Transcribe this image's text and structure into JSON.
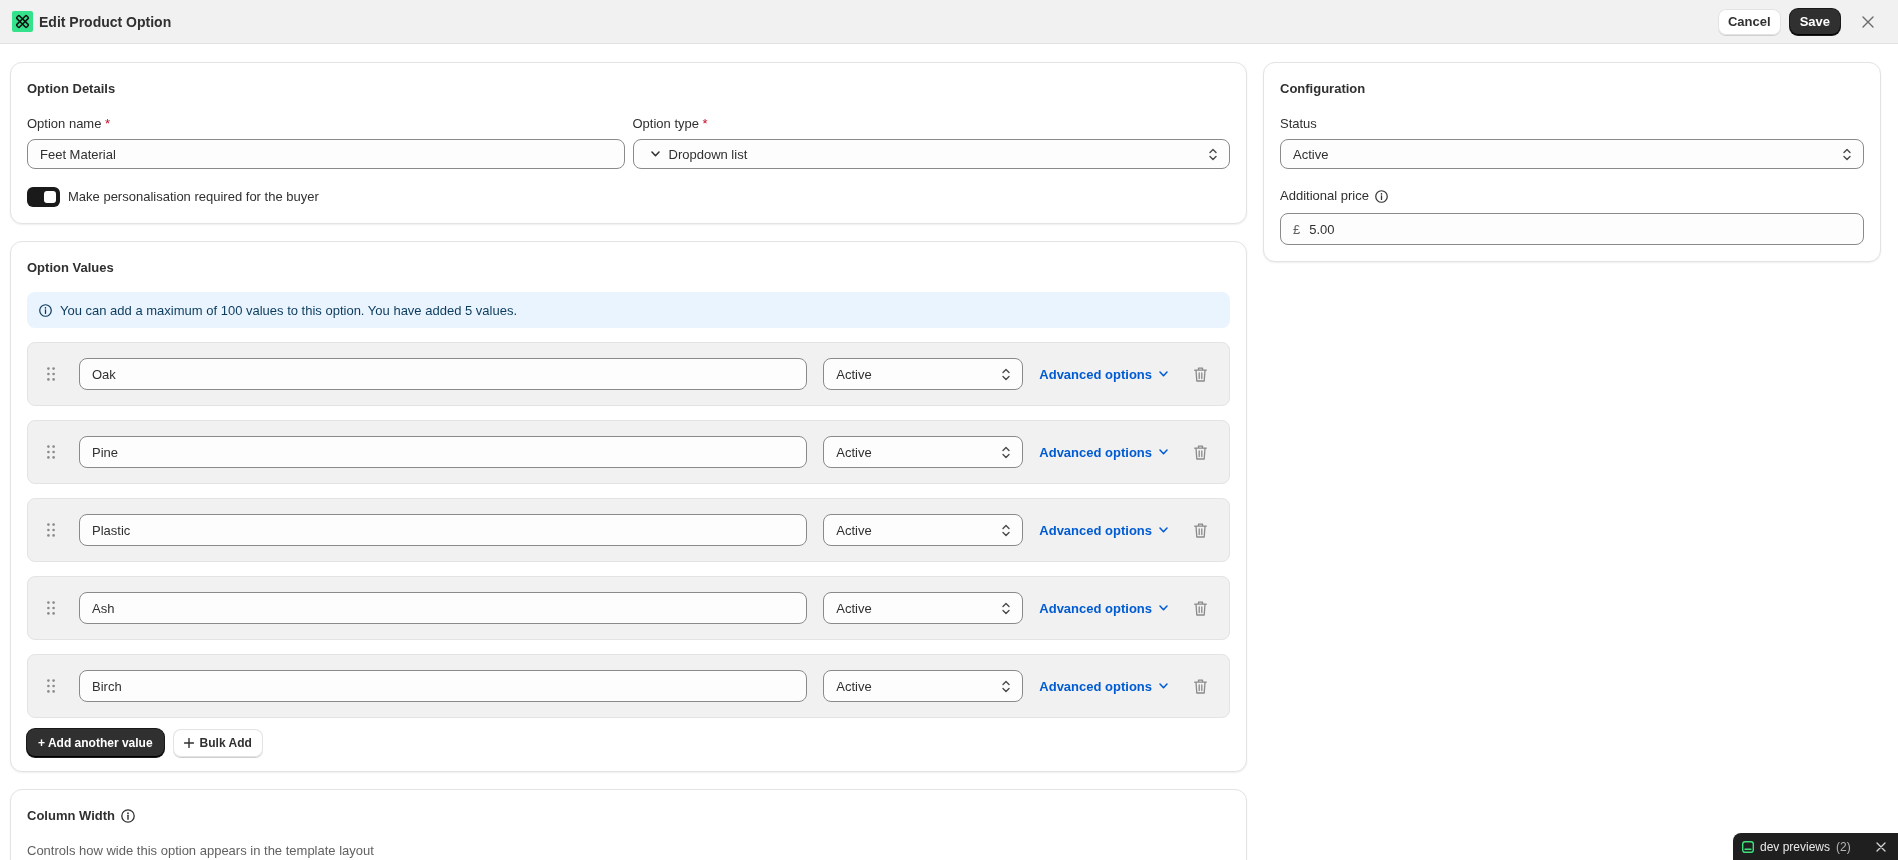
{
  "window": {
    "title": "Edit Product Option"
  },
  "header_actions": [
    {
      "label": "Cancel",
      "kind": "secondary"
    },
    {
      "label": "Save",
      "kind": "primary"
    }
  ],
  "option_details": {
    "title": "Option Details",
    "option_name": {
      "label": "Option name",
      "required_mark": "*",
      "value": "Feet Material"
    },
    "option_type": {
      "label": "Option type",
      "required_mark": "*",
      "value": "Dropdown list"
    },
    "toggle": {
      "label": "Make personalisation required for the buyer",
      "on": true
    }
  },
  "option_values": {
    "title": "Option Values",
    "notice": "You can add a maximum of 100 values to this option. You have added 5 values.",
    "rows": [
      {
        "value": "Oak",
        "status": "Active",
        "link": "Advanced options"
      },
      {
        "value": "Pine",
        "status": "Active",
        "link": "Advanced options"
      },
      {
        "value": "Plastic",
        "status": "Active",
        "link": "Advanced options"
      },
      {
        "value": "Ash",
        "status": "Active",
        "link": "Advanced options"
      },
      {
        "value": "Birch",
        "status": "Active",
        "link": "Advanced options"
      }
    ],
    "buttons": [
      {
        "label": "+ Add another value",
        "kind": "primary"
      },
      {
        "label": "Bulk Add",
        "kind": "secondary"
      }
    ]
  },
  "column_width": {
    "title": "Column Width",
    "description": "Controls how wide this option appears in the template layout"
  },
  "configuration": {
    "title": "Configuration",
    "status": {
      "label": "Status",
      "value": "Active"
    },
    "additional_price": {
      "label": "Additional price",
      "currency": "£",
      "value": "5.00"
    }
  },
  "dev_previews": {
    "label": "dev previews",
    "count": "(2)"
  }
}
